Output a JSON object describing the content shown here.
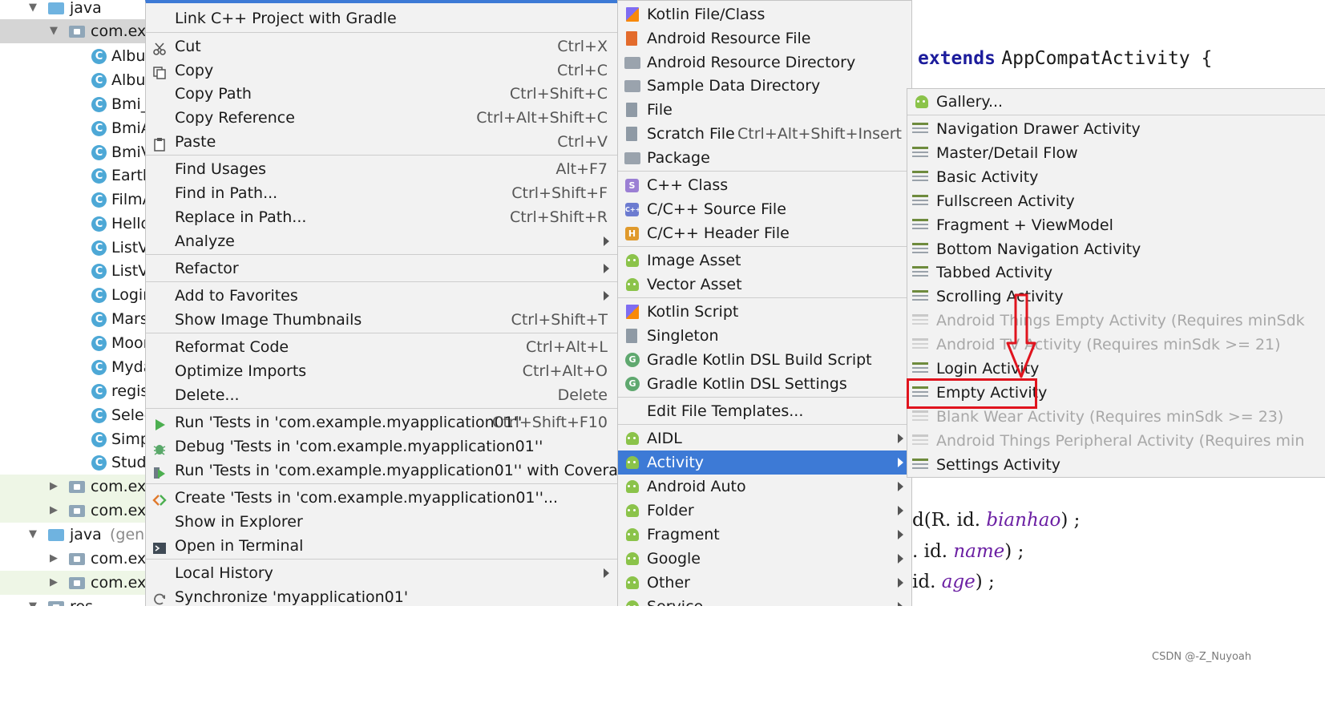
{
  "project_tree": {
    "rows": [
      {
        "label": "java"
      },
      {
        "label": "com.exa"
      },
      {
        "label": "Albur"
      },
      {
        "label": "Albur"
      },
      {
        "label": "Bmi_"
      },
      {
        "label": "BmiA"
      },
      {
        "label": "BmiV"
      },
      {
        "label": "Earth"
      },
      {
        "label": "FilmA"
      },
      {
        "label": "Hello"
      },
      {
        "label": "ListVi"
      },
      {
        "label": "ListVi"
      },
      {
        "label": "Login"
      },
      {
        "label": "Mars"
      },
      {
        "label": "Moon"
      },
      {
        "label": "Myda"
      },
      {
        "label": "regis"
      },
      {
        "label": "Selec"
      },
      {
        "label": "Simp"
      },
      {
        "label": "Stude"
      },
      {
        "label": "com.exa"
      },
      {
        "label": "com.exa"
      },
      {
        "label": "java",
        "suffix": "(genera"
      },
      {
        "label": "com.exa"
      },
      {
        "label": "com.exa"
      },
      {
        "label": "res"
      }
    ],
    "class_letter": "C"
  },
  "context_menu": {
    "items": [
      {
        "label": "Link C++ Project with Gradle",
        "shortcut": ""
      },
      {
        "label": "Cut",
        "shortcut": "Ctrl+X",
        "icon": "scissors-icon"
      },
      {
        "label": "Copy",
        "shortcut": "Ctrl+C",
        "icon": "copy-icon"
      },
      {
        "label": "Copy Path",
        "shortcut": "Ctrl+Shift+C"
      },
      {
        "label": "Copy Reference",
        "shortcut": "Ctrl+Alt+Shift+C"
      },
      {
        "label": "Paste",
        "shortcut": "Ctrl+V",
        "icon": "clipboard-icon"
      },
      {
        "label": "Find Usages",
        "shortcut": "Alt+F7"
      },
      {
        "label": "Find in Path...",
        "shortcut": "Ctrl+Shift+F"
      },
      {
        "label": "Replace in Path...",
        "shortcut": "Ctrl+Shift+R"
      },
      {
        "label": "Analyze",
        "shortcut": ""
      },
      {
        "label": "Refactor",
        "shortcut": ""
      },
      {
        "label": "Add to Favorites",
        "shortcut": ""
      },
      {
        "label": "Show Image Thumbnails",
        "shortcut": "Ctrl+Shift+T"
      },
      {
        "label": "Reformat Code",
        "shortcut": "Ctrl+Alt+L"
      },
      {
        "label": "Optimize Imports",
        "shortcut": "Ctrl+Alt+O"
      },
      {
        "label": "Delete...",
        "shortcut": "Delete"
      },
      {
        "label": "Run 'Tests in 'com.example.myapplication01''",
        "shortcut": "Ctrl+Shift+F10",
        "icon": "run-icon"
      },
      {
        "label": "Debug 'Tests in 'com.example.myapplication01''",
        "shortcut": "",
        "icon": "debug-icon"
      },
      {
        "label": "Run 'Tests in 'com.example.myapplication01'' with Coverage",
        "shortcut": "",
        "icon": "coverage-icon"
      },
      {
        "label": "Create 'Tests in 'com.example.myapplication01''...",
        "shortcut": "",
        "icon": "create-test-icon"
      },
      {
        "label": "Show in Explorer",
        "shortcut": ""
      },
      {
        "label": "Open in Terminal",
        "shortcut": "",
        "icon": "terminal-icon"
      },
      {
        "label": "Local History",
        "shortcut": ""
      },
      {
        "label": "Synchronize 'myapplication01'",
        "shortcut": "",
        "icon": "sync-icon"
      }
    ]
  },
  "new_menu": {
    "items": [
      {
        "label": "Kotlin File/Class"
      },
      {
        "label": "Android Resource File"
      },
      {
        "label": "Android Resource Directory"
      },
      {
        "label": "Sample Data Directory"
      },
      {
        "label": "File"
      },
      {
        "label": "Scratch File",
        "shortcut": "Ctrl+Alt+Shift+Insert"
      },
      {
        "label": "Package"
      },
      {
        "label": "C++ Class",
        "badge": "S"
      },
      {
        "label": "C/C++ Source File",
        "badge": "C++"
      },
      {
        "label": "C/C++ Header File",
        "badge": "H"
      },
      {
        "label": "Image Asset"
      },
      {
        "label": "Vector Asset"
      },
      {
        "label": "Kotlin Script"
      },
      {
        "label": "Singleton"
      },
      {
        "label": "Gradle Kotlin DSL Build Script",
        "badge": "G"
      },
      {
        "label": "Gradle Kotlin DSL Settings",
        "badge": "G"
      },
      {
        "label": "Edit File Templates..."
      },
      {
        "label": "AIDL"
      },
      {
        "label": "Activity"
      },
      {
        "label": "Android Auto"
      },
      {
        "label": "Folder"
      },
      {
        "label": "Fragment"
      },
      {
        "label": "Google"
      },
      {
        "label": "Other"
      },
      {
        "label": "Service"
      }
    ],
    "highlighted": "Activity"
  },
  "activity_menu": {
    "items": [
      {
        "label": "Gallery...",
        "enabled": true
      },
      {
        "label": "Navigation Drawer Activity",
        "enabled": true
      },
      {
        "label": "Master/Detail Flow",
        "enabled": true
      },
      {
        "label": "Basic Activity",
        "enabled": true
      },
      {
        "label": "Fullscreen Activity",
        "enabled": true
      },
      {
        "label": "Fragment + ViewModel",
        "enabled": true
      },
      {
        "label": "Bottom Navigation Activity",
        "enabled": true
      },
      {
        "label": "Tabbed Activity",
        "enabled": true
      },
      {
        "label": "Scrolling Activity",
        "enabled": true
      },
      {
        "label": "Android Things Empty Activity (Requires minSdk",
        "enabled": false
      },
      {
        "label": "Android TV Activity (Requires minSdk >= 21)",
        "enabled": false
      },
      {
        "label": "Login Activity",
        "enabled": true
      },
      {
        "label": "Empty Activity",
        "enabled": true
      },
      {
        "label": "Blank Wear Activity (Requires minSdk >= 23)",
        "enabled": false
      },
      {
        "label": "Android Things Peripheral Activity (Requires min",
        "enabled": false
      },
      {
        "label": "Settings Activity",
        "enabled": true
      }
    ],
    "annotated_item": "Empty Activity"
  },
  "editor": {
    "line1": {
      "keyword": "extends",
      "text": "AppCompatActivity {"
    },
    "line2": {
      "prefix": "d(R. id. ",
      "field": "bianhao",
      "suffix": ") ;"
    },
    "line3": {
      "prefix": ". id. ",
      "field": "name",
      "suffix": ") ;"
    },
    "line4": {
      "prefix": "id. ",
      "field": "age",
      "suffix": ") ;"
    }
  },
  "annotation": {
    "color": "#e0141e"
  },
  "watermark": "CSDN @-Z_Nuyoah",
  "colors": {
    "highlight": "#3d7ad6",
    "android_green": "#8bc34a",
    "annotation_red": "#e0141e"
  }
}
